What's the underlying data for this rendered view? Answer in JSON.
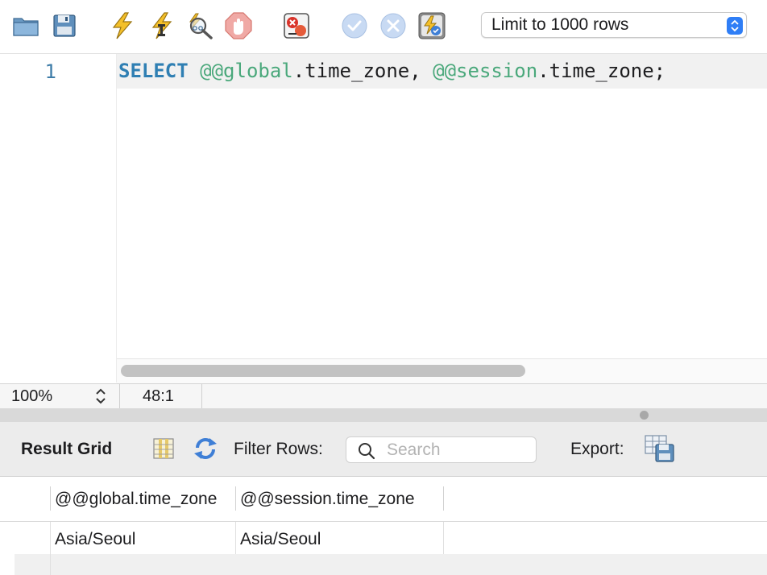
{
  "toolbar": {
    "icons": [
      {
        "name": "open-folder-icon"
      },
      {
        "name": "save-icon"
      },
      {
        "name": "execute-icon"
      },
      {
        "name": "execute-current-statement-icon"
      },
      {
        "name": "explain-icon"
      },
      {
        "name": "stop-icon"
      },
      {
        "name": "toggle-error-continue-icon"
      },
      {
        "name": "commit-icon"
      },
      {
        "name": "rollback-icon"
      },
      {
        "name": "autocommit-toggle-icon"
      }
    ],
    "limit_select": "Limit to 1000 rows"
  },
  "editor": {
    "line_number": "1",
    "code": {
      "keyword": "SELECT",
      "var1": "@@global",
      "part1": ".time_zone, ",
      "var2": "@@session",
      "part2": ".time_zone;"
    }
  },
  "statusbar": {
    "zoom": "100%",
    "cursor_position": "48:1"
  },
  "results_toolbar": {
    "result_grid_label": "Result Grid",
    "filter_label": "Filter Rows:",
    "search_placeholder": "Search",
    "export_label": "Export:"
  },
  "grid": {
    "columns": [
      "@@global.time_zone",
      "@@session.time_zone"
    ],
    "rows": [
      [
        "Asia/Seoul",
        "Asia/Seoul"
      ]
    ]
  },
  "colors": {
    "keyword": "#2f7fb3",
    "variable": "#4aa87b",
    "line_number": "#3d7ca8",
    "select_stepper": "#2f7ef6"
  }
}
